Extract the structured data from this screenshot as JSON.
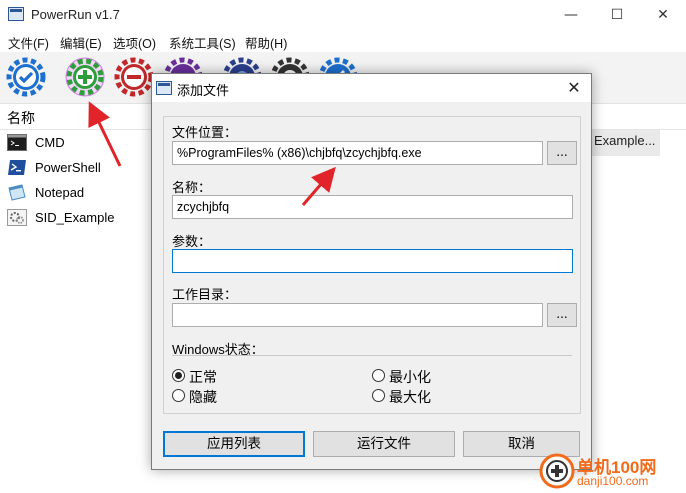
{
  "app": {
    "title": "PowerRun v1.7",
    "window_controls": {
      "minimize": "—",
      "maximize": "☐",
      "close": "✕"
    }
  },
  "menu": {
    "items": [
      "文件(F)",
      "编辑(E)",
      "选项(O)",
      "系统工具(S)",
      "帮助(H)"
    ]
  },
  "toolbar": {
    "buttons": [
      {
        "icon": "check-gear-icon",
        "color": "#1e6fd0"
      },
      {
        "icon": "add-gear-icon",
        "color": "#2e9e3c"
      },
      {
        "icon": "remove-gear-icon",
        "color": "#c0282a"
      },
      {
        "icon": "edit-gear-icon",
        "color": "#6a2f9c"
      },
      {
        "icon": "settings-gear-icon",
        "color": "#2a3f8f"
      },
      {
        "icon": "run-gear-icon",
        "color": "#333333"
      },
      {
        "icon": "about-gear-icon",
        "color": "#1e6fd0"
      }
    ]
  },
  "list": {
    "column_name": "名称",
    "items": [
      {
        "label": "CMD",
        "icon": "cmd-icon"
      },
      {
        "label": "PowerShell",
        "icon": "powershell-icon"
      },
      {
        "label": "Notepad",
        "icon": "notepad-icon"
      },
      {
        "label": "SID_Example",
        "icon": "gears-icon"
      }
    ],
    "detail_text": "Example..."
  },
  "dialog": {
    "title": "添加文件",
    "close": "✕",
    "file_location_label": "文件位置：",
    "file_location_value": "%ProgramFiles% (x86)\\chjbfq\\zcychjbfq.exe",
    "browse_label": "...",
    "name_label": "名称：",
    "name_value": "zcychjbfq",
    "params_label": "参数：",
    "params_value": "",
    "workdir_label": "工作目录：",
    "workdir_value": "",
    "window_state_label": "Windows状态：",
    "radios": {
      "normal": "正常",
      "hidden": "隐藏",
      "minimized": "最小化",
      "maximized": "最大化",
      "selected": "normal"
    },
    "buttons": {
      "apply_list": "应用列表",
      "run_file": "运行文件",
      "cancel": "取消"
    }
  },
  "watermark": {
    "site": "单机100网",
    "domain": "danji100.com"
  },
  "colors": {
    "accent": "#0078d7",
    "annotation_arrow": "#e0242a",
    "watermark": "#f26a1b"
  }
}
